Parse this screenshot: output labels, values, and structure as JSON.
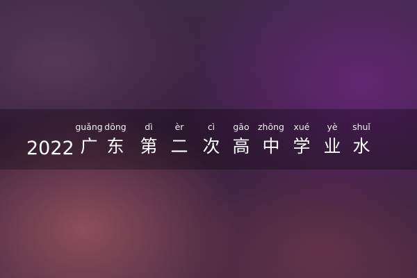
{
  "title": {
    "prefix": "2022",
    "chars": [
      {
        "pinyin": "guǎng",
        "hanzi": "广"
      },
      {
        "pinyin": "dōng",
        "hanzi": "东"
      },
      {
        "pinyin": "dì",
        "hanzi": "第"
      },
      {
        "pinyin": "èr",
        "hanzi": "二"
      },
      {
        "pinyin": "cì",
        "hanzi": "次"
      },
      {
        "pinyin": "gāo",
        "hanzi": "高"
      },
      {
        "pinyin": "zhōng",
        "hanzi": "中"
      },
      {
        "pinyin": "xué",
        "hanzi": "学"
      },
      {
        "pinyin": "yè",
        "hanzi": "业"
      },
      {
        "pinyin": "shuǐ",
        "hanzi": "水"
      }
    ]
  }
}
